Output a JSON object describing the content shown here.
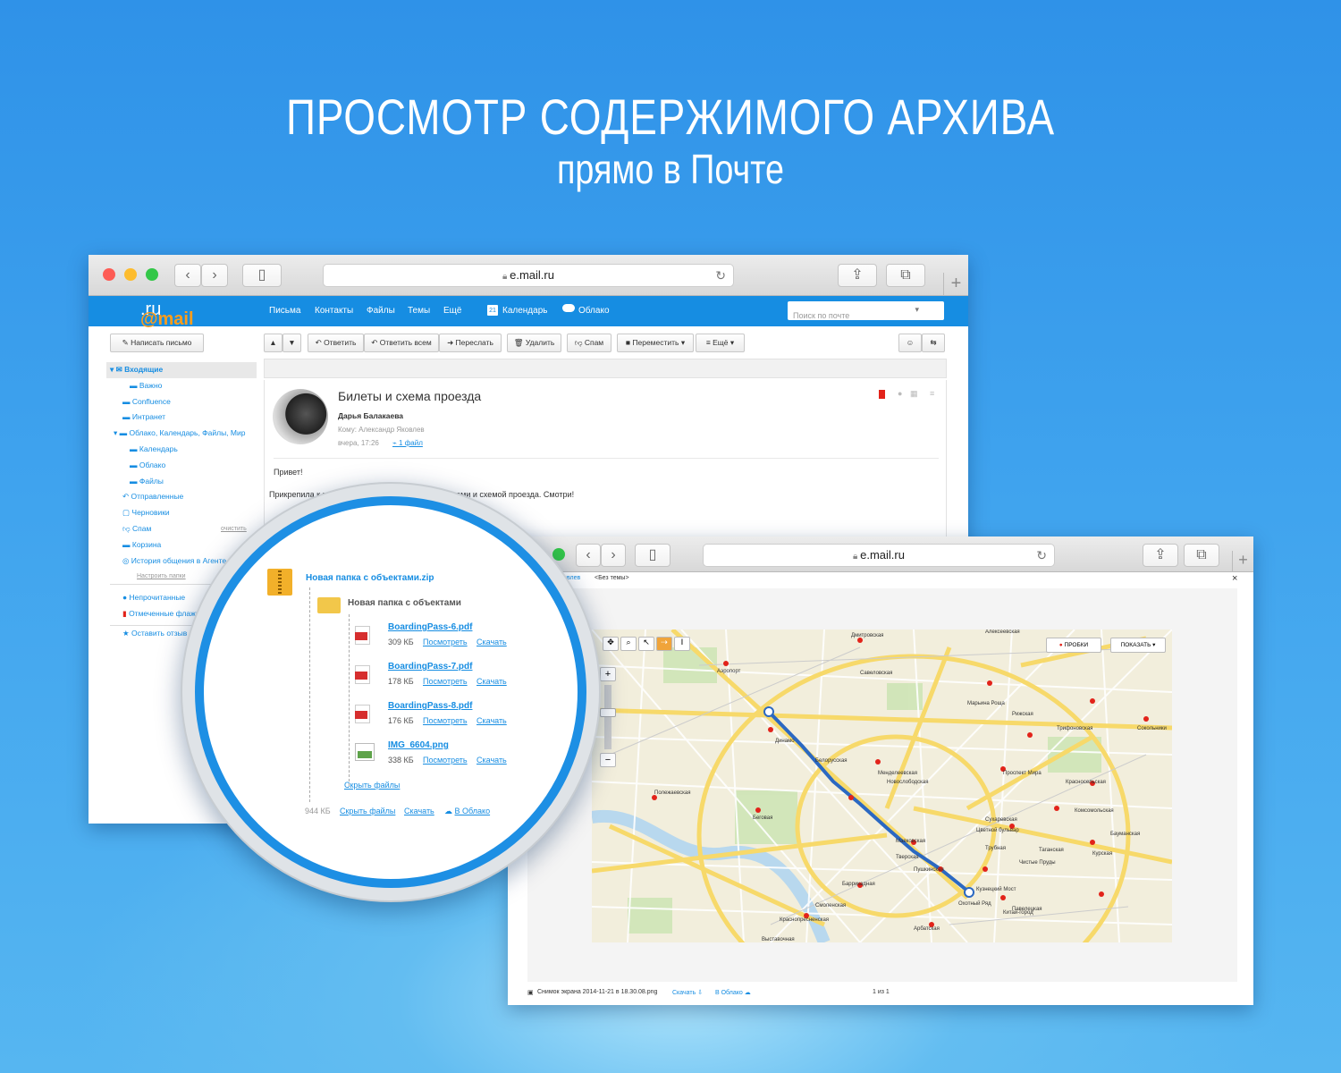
{
  "hero": {
    "title": "ПРОСМОТР СОДЕРЖИМОГО АРХИВА",
    "subtitle": "прямо в Почте"
  },
  "browser": {
    "url": "e.mail.ru"
  },
  "mail": {
    "logo_at": "@mail",
    "logo_tld": ".ru",
    "nav": [
      "Письма",
      "Контакты",
      "Файлы",
      "Темы",
      "Ещё"
    ],
    "calendar": "Календарь",
    "calendar_day": "21",
    "cloud": "Облако",
    "search_placeholder": "Поиск по почте",
    "compose": "Написать письмо",
    "toolbar": {
      "reply": "Ответить",
      "reply_all": "Ответить всем",
      "forward": "Переслать",
      "delete": "Удалить",
      "spam": "Спам",
      "move": "Переместить",
      "more": "Ещё"
    },
    "folders": {
      "inbox": "Входящие",
      "important": "Важно",
      "confluence": "Confluence",
      "intranet": "Интранет",
      "cloud_group": "Облако, Календарь, Файлы, Мир",
      "calendar": "Календарь",
      "cloud": "Облако",
      "files": "Файлы",
      "sent": "Отправленные",
      "drafts": "Черновики",
      "spam": "Спам",
      "clear": "очистить",
      "trash": "Корзина",
      "agent": "История общения в Агенте",
      "configure": "Настроить папки",
      "unread": "Непрочитанные",
      "flagged": "Отмеченные флажком",
      "feedback": "Оставить отзыв"
    },
    "message": {
      "subject": "Билеты и схема проезда",
      "sender": "Дарья Балакаева",
      "to": "Кому: Александр Яковлев",
      "date": "вчера, 17:26",
      "attachments": "1 файл",
      "greeting": "Привет!",
      "body_start": "Прикрепила к письму ар",
      "body_end": "билетами и схемой проезда. Смотри!"
    }
  },
  "archive": {
    "zip": "Новая папка с объектами.zip",
    "folder": "Новая папка с объектами",
    "files": [
      {
        "name": "BoardingPass-6.pdf",
        "size": "309 КБ",
        "icon": "pdf-icon"
      },
      {
        "name": "BoardingPass-7.pdf",
        "size": "178 КБ",
        "icon": "pdf-icon"
      },
      {
        "name": "BoardingPass-8.pdf",
        "size": "176 КБ",
        "icon": "pdf-icon"
      },
      {
        "name": "IMG_6604.png",
        "size": "338 КБ",
        "icon": "image-icon"
      }
    ],
    "view": "Посмотреть",
    "download": "Скачать",
    "hide": "Скрыть файлы",
    "total": "944 КБ",
    "to_cloud": "В Облако"
  },
  "viewer": {
    "crumb_left": "о Яковлев",
    "crumb_right": "<Без темы>",
    "close": "×",
    "traffic": "ПРОБКИ",
    "show": "ПОКАЗАТЬ",
    "filename": "Снимок экрана 2014-11-21 в 18.30.08.png",
    "download": "Скачать",
    "to_cloud": "В Облако",
    "pager": "1 из 1",
    "map_labels": [
      "Дмитровская",
      "Алексеевская",
      "Рижская",
      "Марьина Роща",
      "Савеловская",
      "Динамо",
      "Аэропорт",
      "Белорусская",
      "Менделеевская",
      "Новослободская",
      "Комсомольская",
      "Красносельская",
      "Курская",
      "Павелецкая",
      "Таганская",
      "Китай-город",
      "Кузнецкий Мост",
      "Охотный Ряд",
      "Тверская",
      "Пушкинская",
      "Арбатская",
      "Смоленская",
      "Баррикадная",
      "Краснопресненская",
      "Маяковская",
      "Беговая",
      "Полежаевская",
      "Выставочная",
      "Сухаревская",
      "Трубная",
      "Цветной бульвар",
      "Чистые Пруды",
      "Бауманская",
      "Сокольники",
      "Трифоновская",
      "Проспект Мира"
    ]
  }
}
